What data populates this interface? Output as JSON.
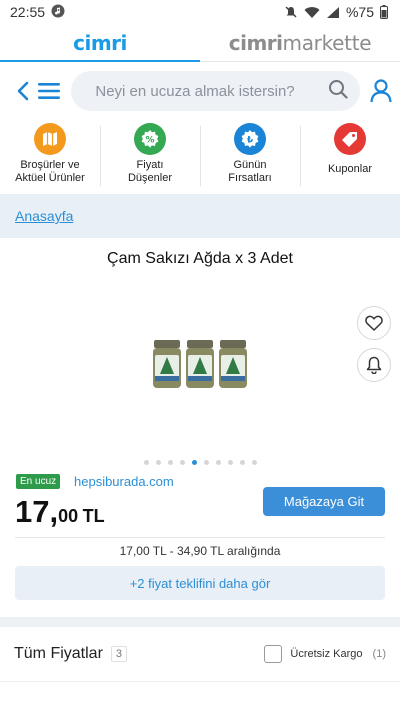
{
  "status_bar": {
    "time": "22:55",
    "battery": "%75"
  },
  "brand_tabs": [
    {
      "part1": "cimri",
      "part2": ""
    },
    {
      "part1": "cimri",
      "part2": "markette"
    }
  ],
  "search": {
    "placeholder": "Neyi en ucuza almak istersin?"
  },
  "categories": [
    {
      "label": "Broşürler ve\nAktüel Ürünler",
      "color": "#f39a1e",
      "icon": "map-icon"
    },
    {
      "label": "Fiyatı\nDüşenler",
      "color": "#34a853",
      "icon": "percent-badge-icon"
    },
    {
      "label": "Günün\nFırsatları",
      "color": "#1a84d6",
      "icon": "lira-badge-icon"
    },
    {
      "label": "Kuponlar",
      "color": "#e53935",
      "icon": "tag-icon"
    }
  ],
  "breadcrumb": {
    "home": "Anasayfa"
  },
  "product": {
    "title": "Çam Sakızı Ağda x 3 Adet",
    "image_dots_total": 10,
    "image_dots_active_index": 4
  },
  "offer": {
    "badge": "En ucuz",
    "seller": "hepsiburada.com",
    "price_main": "17,",
    "price_decimal": "00",
    "price_currency": "TL",
    "store_button": "Mağazaya Git",
    "range_text": "17,00 TL - 34,90 TL aralığında",
    "more_button": "+2 fiyat teklifini daha gör"
  },
  "all_prices": {
    "title": "Tüm Fiyatlar",
    "count": "3",
    "free_shipping_label": "Ücretsiz Kargo",
    "free_shipping_count": "(1)"
  },
  "colors": {
    "accent": "#1a9be6",
    "link": "#2b8fd6",
    "button": "#3b8fd9",
    "badge": "#2e9b4a"
  }
}
